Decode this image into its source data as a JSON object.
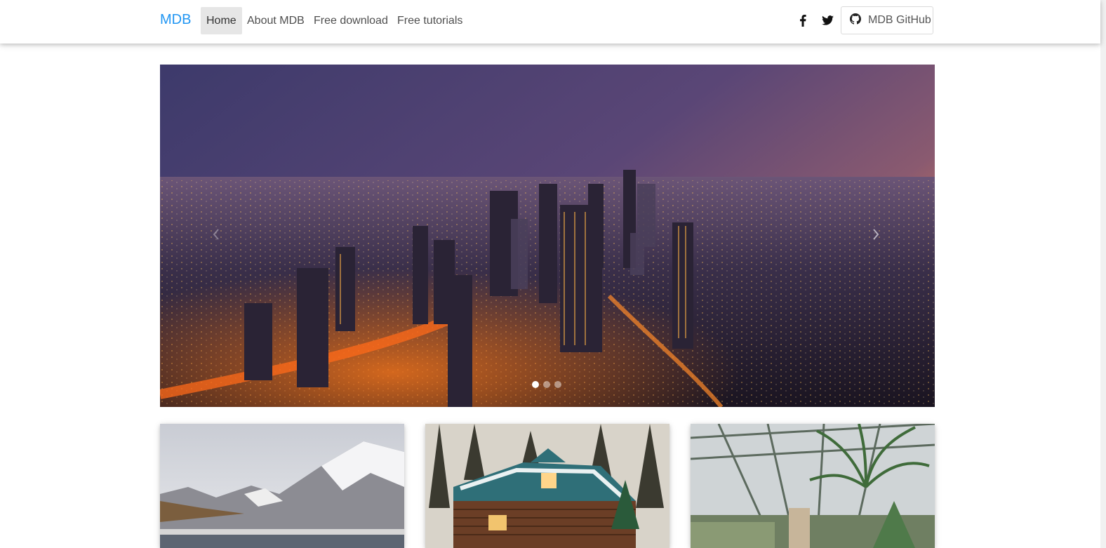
{
  "navbar": {
    "brand": "MDB",
    "links": [
      {
        "label": "Home",
        "active": true
      },
      {
        "label": "About MDB",
        "active": false
      },
      {
        "label": "Free download",
        "active": false
      },
      {
        "label": "Free tutorials",
        "active": false
      }
    ],
    "social": [
      {
        "icon": "facebook-icon"
      },
      {
        "icon": "twitter-icon"
      }
    ],
    "github_button": {
      "icon": "github-icon",
      "label": "MDB GitHub"
    }
  },
  "carousel": {
    "slides": [
      {
        "scene": "city-skyline-at-dusk",
        "active": true
      },
      {
        "scene": "slide-2",
        "active": false
      },
      {
        "scene": "slide-3",
        "active": false
      }
    ],
    "controls": {
      "prev_icon": "chevron-left-icon",
      "next_icon": "chevron-right-icon"
    }
  },
  "cards": [
    {
      "scene": "snowy-mountain-lake"
    },
    {
      "scene": "snowy-log-cabin"
    },
    {
      "scene": "greenhouse-plants"
    }
  ],
  "colors": {
    "brand": "#2196f3",
    "nav_text": "#4f4f4f",
    "nav_active_bg": "#e6e6e6"
  }
}
